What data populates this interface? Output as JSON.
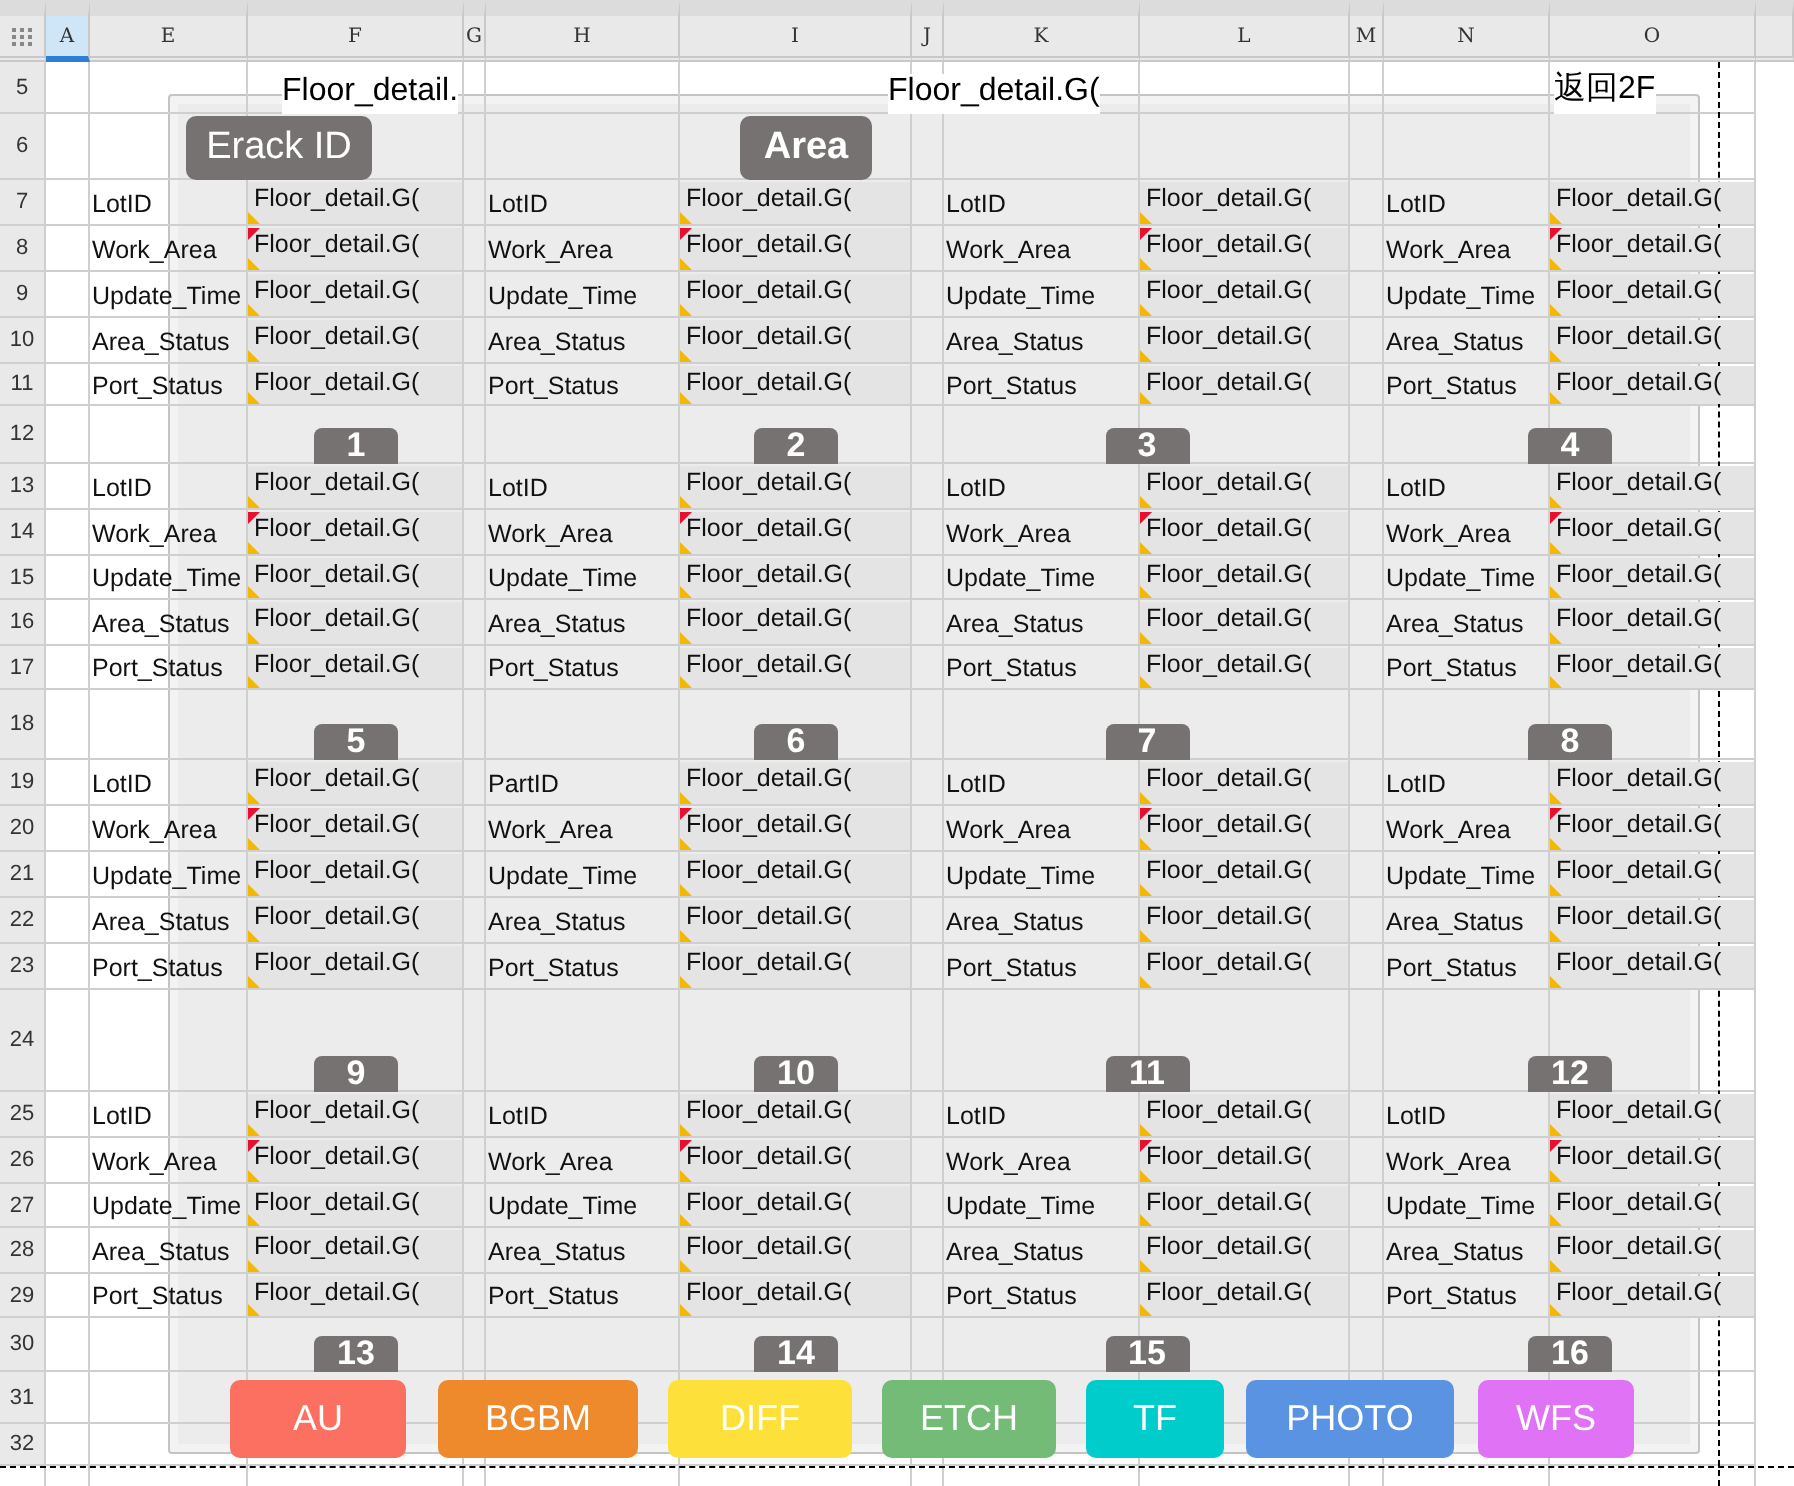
{
  "columns": [
    {
      "label": "A",
      "selected": true
    },
    {
      "label": "E",
      "selected": false
    },
    {
      "label": "F",
      "selected": false
    },
    {
      "label": "G",
      "selected": false
    },
    {
      "label": "H",
      "selected": false
    },
    {
      "label": "I",
      "selected": false
    },
    {
      "label": "J",
      "selected": false
    },
    {
      "label": "K",
      "selected": false
    },
    {
      "label": "L",
      "selected": false
    },
    {
      "label": "M",
      "selected": false
    },
    {
      "label": "N",
      "selected": false
    },
    {
      "label": "O",
      "selected": false
    }
  ],
  "rows": [
    "5",
    "6",
    "7",
    "8",
    "9",
    "10",
    "11",
    "12",
    "13",
    "14",
    "15",
    "16",
    "17",
    "18",
    "19",
    "20",
    "21",
    "22",
    "23",
    "24",
    "25",
    "26",
    "27",
    "28",
    "29",
    "30",
    "31",
    "32"
  ],
  "title_cells": [
    "Floor_detail.",
    "Floor_detail.G(",
    "返回2F"
  ],
  "header_buttons": [
    "Erack ID",
    "Area"
  ],
  "blocks": [
    {
      "number": "1",
      "fields": [
        {
          "label": "LotID",
          "value": "Floor_detail.G(",
          "flagged": false
        },
        {
          "label": "Work_Area",
          "value": "Floor_detail.G(",
          "flagged": true
        },
        {
          "label": "Update_Time",
          "value": "Floor_detail.G(",
          "flagged": false
        },
        {
          "label": "Area_Status",
          "value": "Floor_detail.G(",
          "flagged": false
        },
        {
          "label": "Port_Status",
          "value": "Floor_detail.G(",
          "flagged": false
        }
      ]
    },
    {
      "number": "2",
      "fields": [
        {
          "label": "LotID",
          "value": "Floor_detail.G(",
          "flagged": false
        },
        {
          "label": "Work_Area",
          "value": "Floor_detail.G(",
          "flagged": true
        },
        {
          "label": "Update_Time",
          "value": "Floor_detail.G(",
          "flagged": false
        },
        {
          "label": "Area_Status",
          "value": "Floor_detail.G(",
          "flagged": false
        },
        {
          "label": "Port_Status",
          "value": "Floor_detail.G(",
          "flagged": false
        }
      ]
    },
    {
      "number": "3",
      "fields": [
        {
          "label": "LotID",
          "value": "Floor_detail.G(",
          "flagged": false
        },
        {
          "label": "Work_Area",
          "value": "Floor_detail.G(",
          "flagged": true
        },
        {
          "label": "Update_Time",
          "value": "Floor_detail.G(",
          "flagged": false
        },
        {
          "label": "Area_Status",
          "value": "Floor_detail.G(",
          "flagged": false
        },
        {
          "label": "Port_Status",
          "value": "Floor_detail.G(",
          "flagged": false
        }
      ]
    },
    {
      "number": "4",
      "fields": [
        {
          "label": "LotID",
          "value": "Floor_detail.G(",
          "flagged": false
        },
        {
          "label": "Work_Area",
          "value": "Floor_detail.G(",
          "flagged": true
        },
        {
          "label": "Update_Time",
          "value": "Floor_detail.G(",
          "flagged": false
        },
        {
          "label": "Area_Status",
          "value": "Floor_detail.G(",
          "flagged": false
        },
        {
          "label": "Port_Status",
          "value": "Floor_detail.G(",
          "flagged": false
        }
      ]
    },
    {
      "number": "5",
      "fields": [
        {
          "label": "LotID",
          "value": "Floor_detail.G(",
          "flagged": false
        },
        {
          "label": "Work_Area",
          "value": "Floor_detail.G(",
          "flagged": true
        },
        {
          "label": "Update_Time",
          "value": "Floor_detail.G(",
          "flagged": false
        },
        {
          "label": "Area_Status",
          "value": "Floor_detail.G(",
          "flagged": false
        },
        {
          "label": "Port_Status",
          "value": "Floor_detail.G(",
          "flagged": false
        }
      ]
    },
    {
      "number": "6",
      "fields": [
        {
          "label": "LotID",
          "value": "Floor_detail.G(",
          "flagged": false
        },
        {
          "label": "Work_Area",
          "value": "Floor_detail.G(",
          "flagged": true
        },
        {
          "label": "Update_Time",
          "value": "Floor_detail.G(",
          "flagged": false
        },
        {
          "label": "Area_Status",
          "value": "Floor_detail.G(",
          "flagged": false
        },
        {
          "label": "Port_Status",
          "value": "Floor_detail.G(",
          "flagged": false
        }
      ]
    },
    {
      "number": "7",
      "fields": [
        {
          "label": "LotID",
          "value": "Floor_detail.G(",
          "flagged": false
        },
        {
          "label": "Work_Area",
          "value": "Floor_detail.G(",
          "flagged": true
        },
        {
          "label": "Update_Time",
          "value": "Floor_detail.G(",
          "flagged": false
        },
        {
          "label": "Area_Status",
          "value": "Floor_detail.G(",
          "flagged": false
        },
        {
          "label": "Port_Status",
          "value": "Floor_detail.G(",
          "flagged": false
        }
      ]
    },
    {
      "number": "8",
      "fields": [
        {
          "label": "LotID",
          "value": "Floor_detail.G(",
          "flagged": false
        },
        {
          "label": "Work_Area",
          "value": "Floor_detail.G(",
          "flagged": true
        },
        {
          "label": "Update_Time",
          "value": "Floor_detail.G(",
          "flagged": false
        },
        {
          "label": "Area_Status",
          "value": "Floor_detail.G(",
          "flagged": false
        },
        {
          "label": "Port_Status",
          "value": "Floor_detail.G(",
          "flagged": false
        }
      ]
    },
    {
      "number": "9",
      "fields": [
        {
          "label": "LotID",
          "value": "Floor_detail.G(",
          "flagged": false
        },
        {
          "label": "Work_Area",
          "value": "Floor_detail.G(",
          "flagged": true
        },
        {
          "label": "Update_Time",
          "value": "Floor_detail.G(",
          "flagged": false
        },
        {
          "label": "Area_Status",
          "value": "Floor_detail.G(",
          "flagged": false
        },
        {
          "label": "Port_Status",
          "value": "Floor_detail.G(",
          "flagged": false
        }
      ]
    },
    {
      "number": "10",
      "fields": [
        {
          "label": "PartID",
          "value": "Floor_detail.G(",
          "flagged": false
        },
        {
          "label": "Work_Area",
          "value": "Floor_detail.G(",
          "flagged": true
        },
        {
          "label": "Update_Time",
          "value": "Floor_detail.G(",
          "flagged": false
        },
        {
          "label": "Area_Status",
          "value": "Floor_detail.G(",
          "flagged": false
        },
        {
          "label": "Port_Status",
          "value": "Floor_detail.G(",
          "flagged": false
        }
      ]
    },
    {
      "number": "11",
      "fields": [
        {
          "label": "LotID",
          "value": "Floor_detail.G(",
          "flagged": false
        },
        {
          "label": "Work_Area",
          "value": "Floor_detail.G(",
          "flagged": true
        },
        {
          "label": "Update_Time",
          "value": "Floor_detail.G(",
          "flagged": false
        },
        {
          "label": "Area_Status",
          "value": "Floor_detail.G(",
          "flagged": false
        },
        {
          "label": "Port_Status",
          "value": "Floor_detail.G(",
          "flagged": false
        }
      ]
    },
    {
      "number": "12",
      "fields": [
        {
          "label": "LotID",
          "value": "Floor_detail.G(",
          "flagged": false
        },
        {
          "label": "Work_Area",
          "value": "Floor_detail.G(",
          "flagged": true
        },
        {
          "label": "Update_Time",
          "value": "Floor_detail.G(",
          "flagged": false
        },
        {
          "label": "Area_Status",
          "value": "Floor_detail.G(",
          "flagged": false
        },
        {
          "label": "Port_Status",
          "value": "Floor_detail.G(",
          "flagged": false
        }
      ]
    },
    {
      "number": "13",
      "fields": [
        {
          "label": "LotID",
          "value": "Floor_detail.G(",
          "flagged": false
        },
        {
          "label": "Work_Area",
          "value": "Floor_detail.G(",
          "flagged": true
        },
        {
          "label": "Update_Time",
          "value": "Floor_detail.G(",
          "flagged": false
        },
        {
          "label": "Area_Status",
          "value": "Floor_detail.G(",
          "flagged": false
        },
        {
          "label": "Port_Status",
          "value": "Floor_detail.G(",
          "flagged": false
        }
      ]
    },
    {
      "number": "14",
      "fields": [
        {
          "label": "LotID",
          "value": "Floor_detail.G(",
          "flagged": false
        },
        {
          "label": "Work_Area",
          "value": "Floor_detail.G(",
          "flagged": true
        },
        {
          "label": "Update_Time",
          "value": "Floor_detail.G(",
          "flagged": false
        },
        {
          "label": "Area_Status",
          "value": "Floor_detail.G(",
          "flagged": false
        },
        {
          "label": "Port_Status",
          "value": "Floor_detail.G(",
          "flagged": false
        }
      ]
    },
    {
      "number": "15",
      "fields": [
        {
          "label": "LotID",
          "value": "Floor_detail.G(",
          "flagged": false
        },
        {
          "label": "Work_Area",
          "value": "Floor_detail.G(",
          "flagged": true
        },
        {
          "label": "Update_Time",
          "value": "Floor_detail.G(",
          "flagged": false
        },
        {
          "label": "Area_Status",
          "value": "Floor_detail.G(",
          "flagged": false
        },
        {
          "label": "Port_Status",
          "value": "Floor_detail.G(",
          "flagged": false
        }
      ]
    },
    {
      "number": "16",
      "fields": [
        {
          "label": "LotID",
          "value": "Floor_detail.G(",
          "flagged": false
        },
        {
          "label": "Work_Area",
          "value": "Floor_detail.G(",
          "flagged": true
        },
        {
          "label": "Update_Time",
          "value": "Floor_detail.G(",
          "flagged": false
        },
        {
          "label": "Area_Status",
          "value": "Floor_detail.G(",
          "flagged": false
        },
        {
          "label": "Port_Status",
          "value": "Floor_detail.G(",
          "flagged": false
        }
      ]
    }
  ],
  "area_buttons": [
    {
      "label": "AU",
      "color": "#fb7060"
    },
    {
      "label": "BGBM",
      "color": "#ee8a2c"
    },
    {
      "label": "DIFF",
      "color": "#fde03a"
    },
    {
      "label": "ETCH",
      "color": "#74bb78"
    },
    {
      "label": "TF",
      "color": "#00cccc"
    },
    {
      "label": "PHOTO",
      "color": "#5b93e3"
    },
    {
      "label": "WFS",
      "color": "#df72f5"
    }
  ]
}
